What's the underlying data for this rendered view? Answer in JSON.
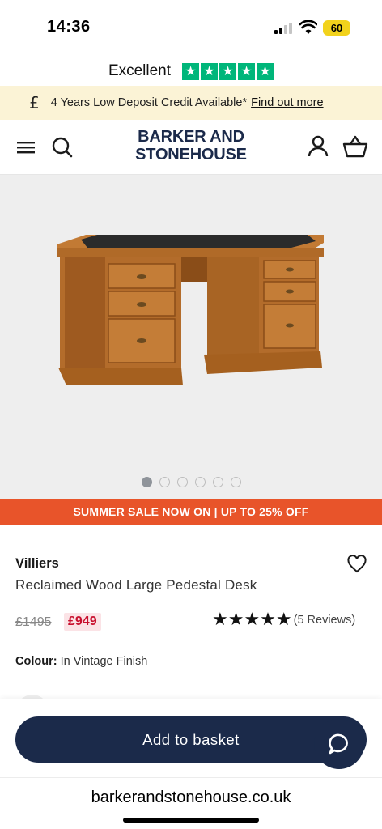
{
  "status_bar": {
    "time": "14:36",
    "battery": "60"
  },
  "trustpilot": {
    "label": "Excellent",
    "stars": [
      "★",
      "★",
      "★",
      "★",
      "★"
    ]
  },
  "promo": {
    "currency_symbol": "£",
    "text": "4 Years Low Deposit Credit Available*",
    "link": "Find out more"
  },
  "header": {
    "logo_line1": "BARKER AND",
    "logo_line2": "STONEHOUSE",
    "icons": [
      "menu-icon",
      "search-icon",
      "account-icon",
      "basket-icon"
    ]
  },
  "gallery": {
    "slide_count": 6,
    "active_slide": 1
  },
  "sale_banner": "SUMMER SALE NOW ON | UP TO 25% OFF",
  "product": {
    "brand": "Villiers",
    "name": "Reclaimed Wood Large Pedestal Desk",
    "old_price": "£1495",
    "price": "£949",
    "rating_stars": "★★★★★",
    "reviews": "(5 Reviews)",
    "colour_label": "Colour:",
    "colour_value": "In Vintage Finish"
  },
  "basket": {
    "button_label": "Add to basket"
  },
  "browser": {
    "url": "barkerandstonehouse.co.uk"
  },
  "colors": {
    "navy": "#1b2a4a",
    "sale_orange": "#e8542a",
    "promo_bg": "#fbf3d6",
    "trust_green": "#00b67a",
    "price_red": "#c8102e"
  }
}
